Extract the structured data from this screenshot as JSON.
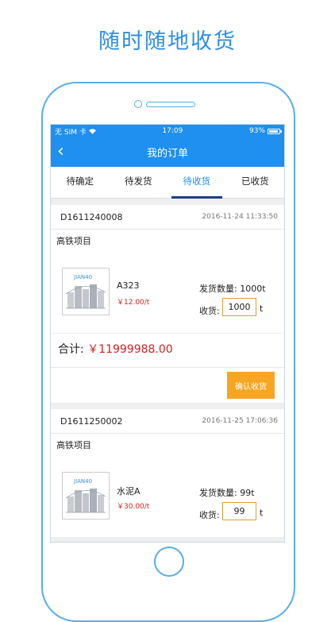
{
  "headline": "随时随地收货",
  "status_bar": {
    "carrier": "无 SIM 卡",
    "time": "17:09",
    "battery": "93%"
  },
  "nav": {
    "back": "‹",
    "title": "我的订单"
  },
  "tabs": [
    {
      "label": "待确定"
    },
    {
      "label": "待发货"
    },
    {
      "label": "待收货",
      "active": true
    },
    {
      "label": "已收货"
    }
  ],
  "orders": [
    {
      "order_no": "D1611240008",
      "time": "2016-11-24 11:33:50",
      "project": "高铁项目",
      "thumb_label": "JIAN40",
      "product": "A323",
      "price": "￥12.00/t",
      "ship_qty": "发货数量: 1000t",
      "recv_label": "收货:",
      "recv_value": "1000",
      "unit": "t",
      "total_label": "合计:",
      "total_amount": "￥11999988.00",
      "confirm_label": "确认收货"
    },
    {
      "order_no": "D1611250002",
      "time": "2016-11-25 17:06:36",
      "project": "高铁项目",
      "thumb_label": "JIAN40",
      "product": "水泥A",
      "price": "￥30.00/t",
      "ship_qty": "发货数量: 99t",
      "recv_label": "收货:",
      "recv_value": "99",
      "unit": "t"
    }
  ],
  "colors": {
    "primary": "#1f8ff0",
    "accent": "#f6a623",
    "price": "#d02020",
    "phone_outline": "#56aee9"
  }
}
